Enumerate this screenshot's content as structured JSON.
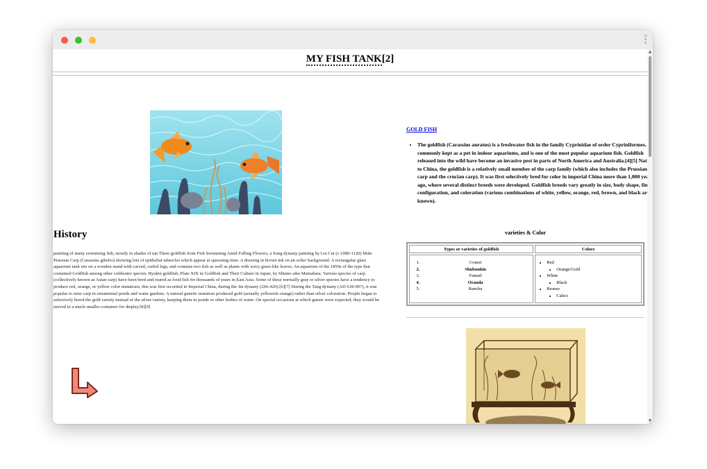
{
  "window": {
    "controls": [
      "close",
      "minimize",
      "maximize"
    ]
  },
  "page": {
    "title_abbr": "MY FISH TANK",
    "title_ref": "[2]"
  },
  "history": {
    "heading": "History",
    "text": "painting of many swimming fish, mostly in shades of tan Three goldfish from Fish Swimming Amid Falling Flowers, a Song dynasty painting by Liu Cai (c.1080-1120) Male Prussian Carp (Carassius gibelio) showing lots of epithelial tubercles which appear at spawning time. A drawing in brown ink on an ochre background. A rectangular glass aquarium tank sits on a wooden stand with carved, curled legs, and contains two fish as well as plants with wavy grass-like leaves. An aquarium of the 1850s of the type that contained Goldfish among other coldwater species. Ryukin goldfish, Plate XIX in Goldfish and Their Culture in Japan, by Shinno aike Matsubara. Various species of carp (collectively known as Asian carp) have been bred and reared as food fish for thousands of years in East Asia. Some of these normally gray or silver species have a tendency to produce red, orange, or yellow color mutations; this was first recorded in Imperial China, during the Jin dynasty (266-420).[6][7] During the Tang dynasty (AD 618-907), it was popular to raise carp in ornamental ponds and water gardens. A natural genetic mutation produced gold (actually yellowish orange) rather than silver coloration. People began to selectively breed the gold variety instead of the silver variety, keeping them in ponds or other bodies of water. On special occasions at which guests were expected, they would be moved to a much smaller container for display.[8][9]"
  },
  "goldfish": {
    "link": "GOLD FISH",
    "description": "The goldfish (Carassius auratus) is a freshwater fish in the family Cyprinidae of order Cypriniformes. It is commonly kept as a pet in indoor aquariums, and is one of the most popular aquarium fish. Goldfish released into the wild have become an invasive pest in parts of North America and Australia.[4][5] Native to China, the goldfish is a relatively small member of the carp family (which also includes the Prussian carp and the crucian carp). It was first selectively bred for color in imperial China more than 1,000 years ago, where several distinct breeds were developed. Goldfish breeds vary greatly in size, body shape, fin configuration, and coloration (various combinations of white, yellow, orange, red, brown, and black are known)."
  },
  "varieties_table": {
    "caption": "varieties & Color",
    "headers": [
      "Types or varieties of goldfish",
      "Colors"
    ],
    "types": [
      "Comet",
      "Shubunkin",
      "Fantail",
      "Oranda",
      "Ranchu"
    ],
    "colors": [
      {
        "name": "Red",
        "sub": "Orange/Gold"
      },
      {
        "name": "White",
        "sub": "Black"
      },
      {
        "name": "Bronze",
        "sub": "Calico"
      }
    ]
  },
  "icons": {
    "corner_arrow": "arrow-turn-right-icon",
    "arrow_fill": "#f08a78",
    "arrow_stroke": "#7a2a20"
  }
}
